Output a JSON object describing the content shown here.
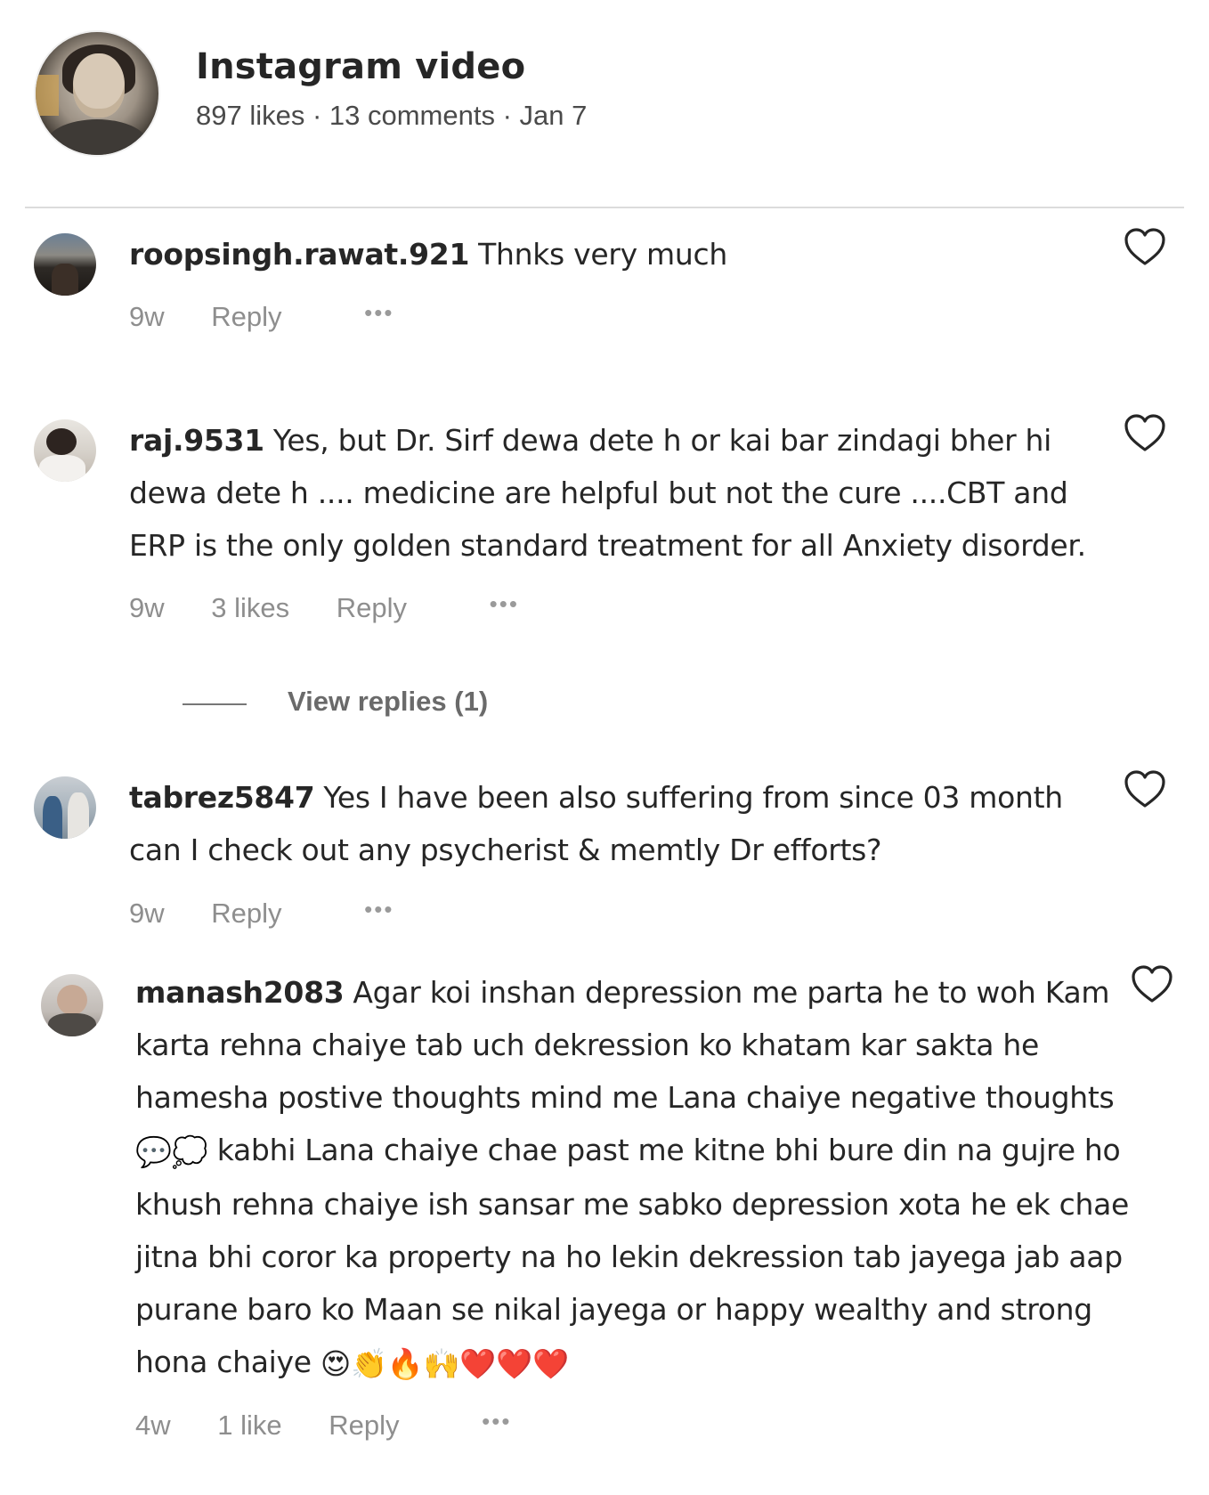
{
  "post": {
    "title": "Instagram video",
    "meta": "897 likes · 13 comments · Jan 7"
  },
  "comments": [
    {
      "username": "roopsingh.rawat.921",
      "text": "Thnks very much",
      "time": "9w",
      "likes": "",
      "reply_label": "Reply",
      "more_label": "•••"
    },
    {
      "username": "raj.9531",
      "text": "Yes, but Dr. Sirf dewa dete h or kai bar zindagi bher hi dewa dete h .... medicine are helpful but not the cure ....CBT and ERP is the only golden standard treatment for all Anxiety disorder.",
      "time": "9w",
      "likes": "3 likes",
      "reply_label": "Reply",
      "more_label": "•••",
      "view_replies": "View replies (1)"
    },
    {
      "username": "tabrez5847",
      "text": "Yes I have been also suffering from since 03 month can I check out any psycherist & memtly Dr efforts?",
      "time": "9w",
      "likes": "",
      "reply_label": "Reply",
      "more_label": "•••"
    },
    {
      "username": "manash2083",
      "text_part1": "Agar koi inshan depression me parta he to woh Kam karta rehna chaiye tab uch dekression ko khatam kar sakta he hamesha postive thoughts mind me Lana chaiye negative thoughts",
      "text_emoji1": "💬💭",
      "text_part2": "kabhi Lana chaiye chae past me kitne bhi bure din na gujre ho khush rehna chaiye ish sansar me sabko depression xota he ek chae jitna bhi coror ka property na ho lekin dekression tab jayega jab aap purane baro ko Maan se nikal jayega or happy wealthy and strong hona chaiye",
      "text_emoji2": "😍👏🔥🙌❤️❤️❤️",
      "time": "4w",
      "likes": "1 like",
      "reply_label": "Reply",
      "more_label": "•••"
    }
  ],
  "icons": {
    "like": "heart-outline-icon",
    "more": "more-dots-icon"
  },
  "colors": {
    "text": "#262626",
    "secondary": "#8e8e8e",
    "divider": "#dcdcdc"
  }
}
